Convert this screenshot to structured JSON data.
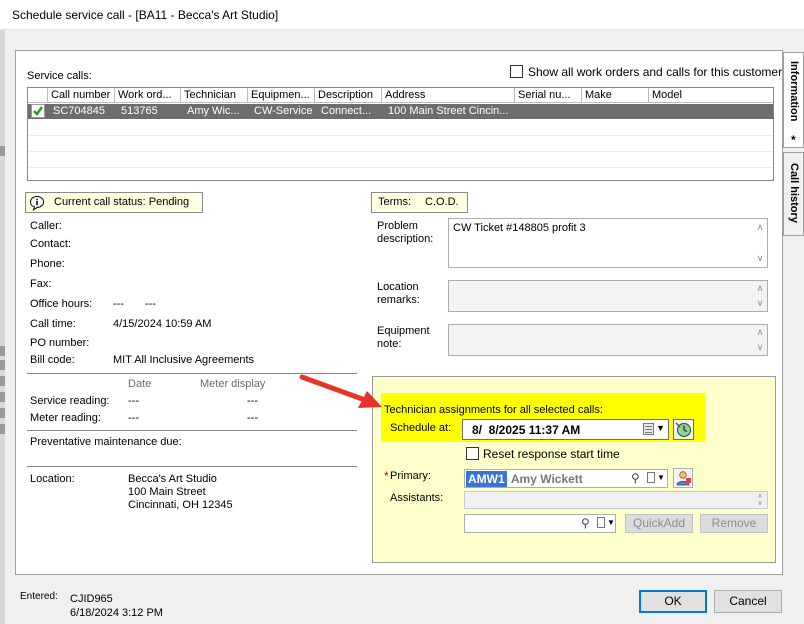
{
  "window": {
    "title": "Schedule service call - [BA11 - Becca's Art Studio]"
  },
  "side_tabs": [
    {
      "label": "Information"
    },
    {
      "label": "Call history"
    }
  ],
  "information_tab_marker": "*",
  "service_calls": {
    "label": "Service calls:",
    "show_all_label": "Show all work orders and calls for this customer",
    "columns": [
      "Call number",
      "Work ord...",
      "Technician",
      "Equipmen...",
      "Description",
      "Address",
      "Serial nu...",
      "Make",
      "Model"
    ],
    "rows": [
      {
        "call_number": "SC704845",
        "work_order": "513765",
        "technician": "Amy Wic...",
        "equipment": "CW-Service",
        "description": "Connect...",
        "address": "100 Main Street Cincin...",
        "serial": "",
        "make": "",
        "model": ""
      }
    ]
  },
  "status": {
    "text": "Current call status: Pending"
  },
  "terms": {
    "label": "Terms:",
    "value": "C.O.D."
  },
  "details": {
    "caller": "Caller:",
    "contact": "Contact:",
    "phone": "Phone:",
    "fax": "Fax:",
    "office_hours_label": "Office hours:",
    "office_hours_open": "---",
    "office_hours_close": "---",
    "call_time_label": "Call time:",
    "call_time_value": "4/15/2024 10:59 AM",
    "po_number": "PO number:",
    "bill_code_label": "Bill code:",
    "bill_code_value": "MIT All Inclusive Agreements"
  },
  "readings": {
    "date_header": "Date",
    "meter_header": "Meter display",
    "service_label": "Service reading:",
    "service_date": "---",
    "service_meter": "---",
    "meter_label": "Meter reading:",
    "meter_date": "---",
    "meter_meter": "---"
  },
  "pm": {
    "label": "Preventative maintenance due:"
  },
  "location": {
    "label": "Location:",
    "name": "Becca's Art Studio",
    "street": "100 Main Street",
    "city": "Cincinnati, OH 12345"
  },
  "problem": {
    "label_1": "Problem",
    "label_2": "description:",
    "value": "CW Ticket #148805 profit 3"
  },
  "location_remarks": {
    "label_1": "Location",
    "label_2": "remarks:",
    "value": ""
  },
  "equipment_note": {
    "label_1": "Equipment",
    "label_2": "note:",
    "value": ""
  },
  "assignment": {
    "title": "Technician assignments for all selected calls:",
    "schedule_label": "Schedule at:",
    "schedule_value": "8/  8/2025 11:37 AM",
    "reset_label": "Reset response start time",
    "primary_required": "*",
    "primary_label": "Primary:",
    "primary_code": "AMW1",
    "primary_name": "- Amy Wickett",
    "assistants_label": "Assistants:",
    "quickadd_label": "QuickAdd",
    "remove_label": "Remove"
  },
  "entered": {
    "label": "Entered:",
    "user": "CJID965",
    "date": "6/18/2024 3:12 PM"
  },
  "buttons": {
    "ok": "OK",
    "cancel": "Cancel"
  },
  "colors": {
    "highlight": "#ffff00",
    "panel_yellow": "#ffffcc",
    "selected_row": "#6d6d6d",
    "arrow": "#e8332b",
    "accent": "#0078d7"
  }
}
